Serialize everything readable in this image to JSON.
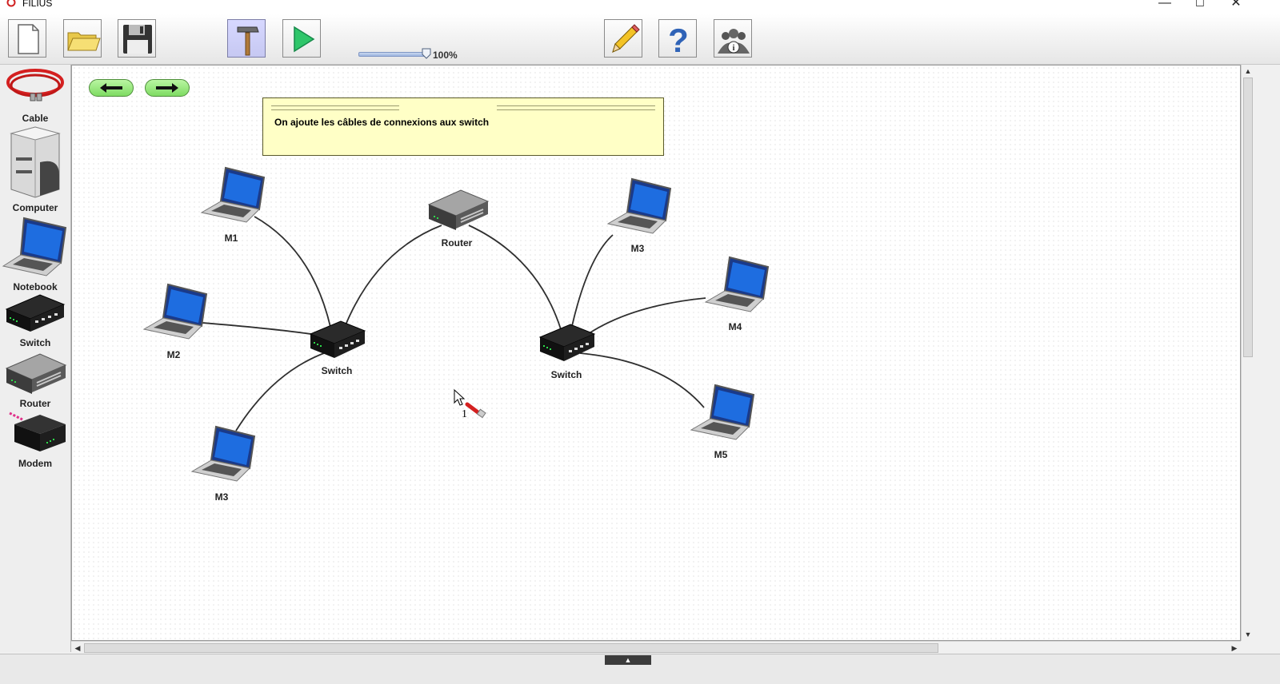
{
  "window": {
    "title": "FILIUS",
    "minimize": "—",
    "maximize": "☐",
    "close": "✕"
  },
  "toolbar": {
    "buttons": [
      {
        "name": "new-file",
        "icon": "new-document-icon"
      },
      {
        "name": "open-file",
        "icon": "folder-icon"
      },
      {
        "name": "save-file",
        "icon": "floppy-disk-icon"
      },
      {
        "name": "design-mode",
        "icon": "hammer-icon",
        "active": true
      },
      {
        "name": "simulation-mode",
        "icon": "play-icon"
      },
      {
        "name": "edit",
        "icon": "pencil-icon"
      },
      {
        "name": "help",
        "icon": "question-icon"
      },
      {
        "name": "about",
        "icon": "info-users-icon"
      }
    ],
    "zoom_label": "100%",
    "zoom_value": 1.0
  },
  "palette": {
    "items": [
      {
        "label": "Cable",
        "icon": "cable-icon"
      },
      {
        "label": "Computer",
        "icon": "computer-icon"
      },
      {
        "label": "Notebook",
        "icon": "notebook-icon"
      },
      {
        "label": "Switch",
        "icon": "switch-icon"
      },
      {
        "label": "Router",
        "icon": "router-icon"
      },
      {
        "label": "Modem",
        "icon": "modem-icon"
      }
    ]
  },
  "note": {
    "text": "On ajoute les câbles de connexions aux switch"
  },
  "nodes": {
    "m1": "M1",
    "m2": "M2",
    "m3_left": "M3",
    "switch_left": "Switch",
    "router": "Router",
    "switch_right": "Switch",
    "m3_right": "M3",
    "m4": "M4",
    "m5": "M5"
  },
  "cursor": {
    "cable_count": "1"
  },
  "colors": {
    "note_background": "#ffffc6",
    "nav_button_green": "#7fdc63",
    "active_tool": "#c6c8f2",
    "cable_red": "#d42020"
  }
}
